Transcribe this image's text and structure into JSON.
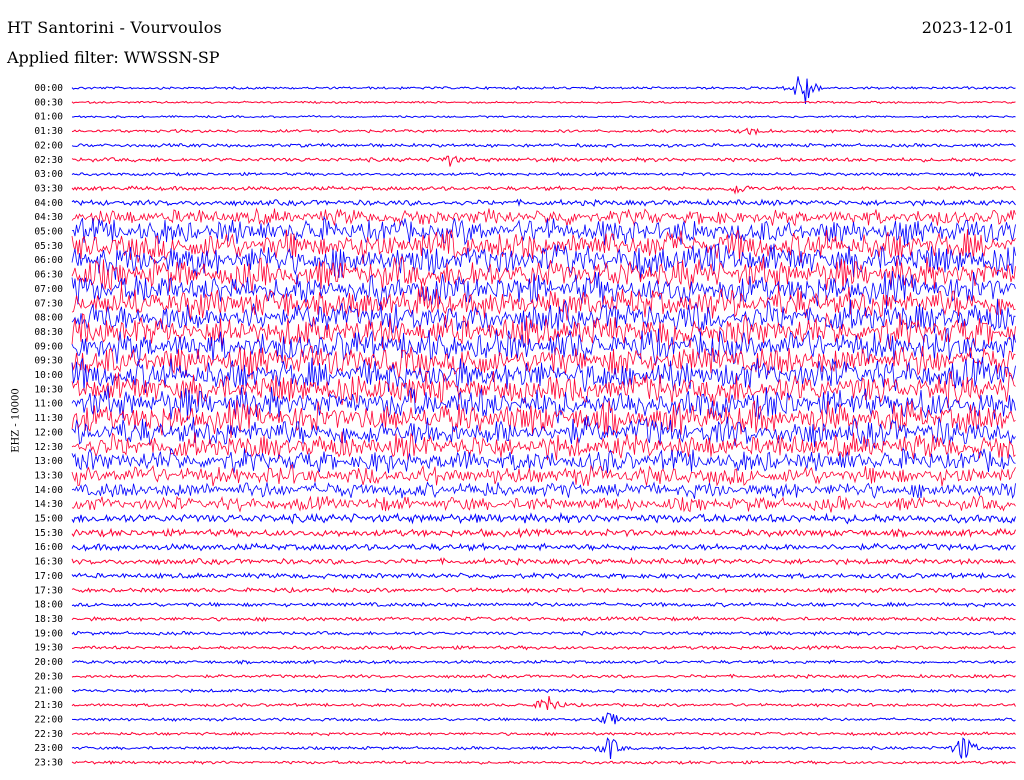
{
  "header": {
    "station": "HT Santorini - Vourvoulos",
    "date": "2023-12-01",
    "filter_label": "Applied filter: WWSSN-SP"
  },
  "chart_data": {
    "type": "line",
    "ylabel": "EHZ - 10000",
    "xlabel": "",
    "title": "HT Santorini - Vourvoulos",
    "row_labels": [
      "00:00",
      "00:30",
      "01:00",
      "01:30",
      "02:00",
      "02:30",
      "03:00",
      "03:30",
      "04:00",
      "04:30",
      "05:00",
      "05:30",
      "06:00",
      "06:30",
      "07:00",
      "07:30",
      "08:00",
      "08:30",
      "09:00",
      "09:30",
      "10:00",
      "10:30",
      "11:00",
      "11:30",
      "12:00",
      "12:30",
      "13:00",
      "13:30",
      "14:00",
      "14:30",
      "15:00",
      "15:30",
      "16:00",
      "16:30",
      "17:00",
      "17:30",
      "18:00",
      "18:30",
      "19:00",
      "19:30",
      "20:00",
      "20:30",
      "21:00",
      "21:30",
      "22:00",
      "22:30",
      "23:00",
      "23:30"
    ],
    "row_amplitudes": [
      1.0,
      0.8,
      0.8,
      1.2,
      1.4,
      1.6,
      1.2,
      1.6,
      2.2,
      5.0,
      8.0,
      9.5,
      10.0,
      10.0,
      10.0,
      10.0,
      10.0,
      10.0,
      10.0,
      10.0,
      10.0,
      10.0,
      10.0,
      10.0,
      9.0,
      8.0,
      7.0,
      6.0,
      5.0,
      4.5,
      3.5,
      2.8,
      2.6,
      2.2,
      2.0,
      1.7,
      1.6,
      1.5,
      1.4,
      1.4,
      1.3,
      1.3,
      1.3,
      1.2,
      1.2,
      1.2,
      1.2,
      1.2
    ],
    "events": [
      {
        "row": 0,
        "x": 0.775,
        "amp": 30
      },
      {
        "row": 3,
        "x": 0.72,
        "amp": 5
      },
      {
        "row": 5,
        "x": 0.4,
        "amp": 6
      },
      {
        "row": 7,
        "x": 0.705,
        "amp": 6
      },
      {
        "row": 43,
        "x": 0.505,
        "amp": 14
      },
      {
        "row": 44,
        "x": 0.57,
        "amp": 10
      },
      {
        "row": 46,
        "x": 0.57,
        "amp": 14
      },
      {
        "row": 46,
        "x": 0.945,
        "amp": 18
      }
    ],
    "colors": [
      "#0000ff",
      "#ff0033"
    ],
    "grid": false
  }
}
